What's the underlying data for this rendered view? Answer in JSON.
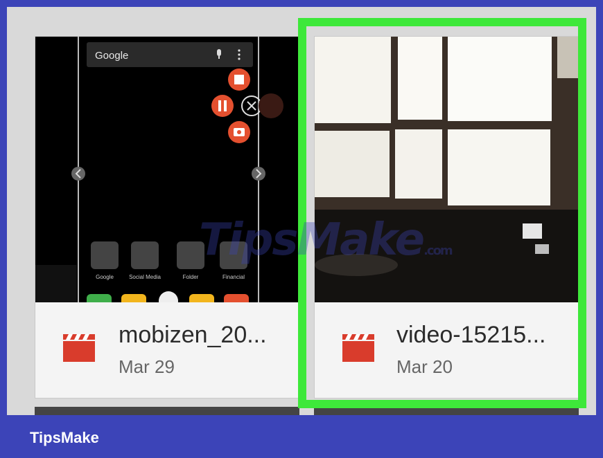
{
  "cards": [
    {
      "name": "mobizen_20...",
      "date": "Mar 29"
    },
    {
      "name": "video-15215...",
      "date": "Mar 20"
    }
  ],
  "phone_preview": {
    "search_label": "Google",
    "folders": [
      "Google",
      "Social Media",
      "Folder",
      "Financial"
    ]
  },
  "watermark": {
    "text": "TipsMake",
    "suffix": ".com"
  },
  "footer": {
    "brand": "TipsMake"
  },
  "colors": {
    "highlight": "#3ee83a",
    "brand_bar": "#3c44b8",
    "video_icon": "#d93c2c"
  },
  "icons": [
    "video-file-icon",
    "microphone-icon",
    "more-vertical-icon",
    "stop-icon",
    "pause-icon",
    "close-icon",
    "camera-icon",
    "chevron-left-icon",
    "chevron-right-icon"
  ]
}
